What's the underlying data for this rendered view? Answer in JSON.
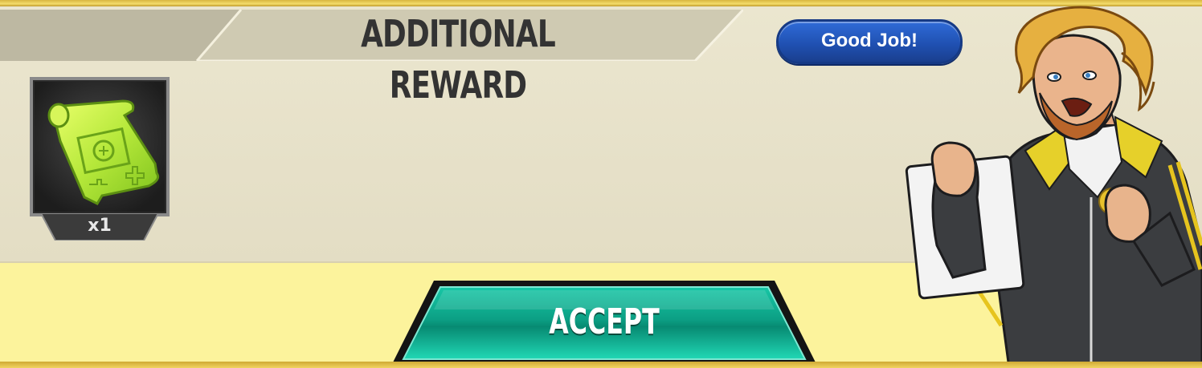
{
  "dialog": {
    "title": "ADDITIONAL REWARD",
    "speech": "Good Job!",
    "reward": {
      "icon": "blueprint-scroll-icon",
      "quantity": "x1"
    },
    "accept_label": "ACCEPT"
  },
  "colors": {
    "panel": "#e6e1c9",
    "background": "#fcf39c",
    "accept_teal": "#0fa58a",
    "badge_blue": "#2257c0",
    "gold_border": "#e6c556"
  }
}
